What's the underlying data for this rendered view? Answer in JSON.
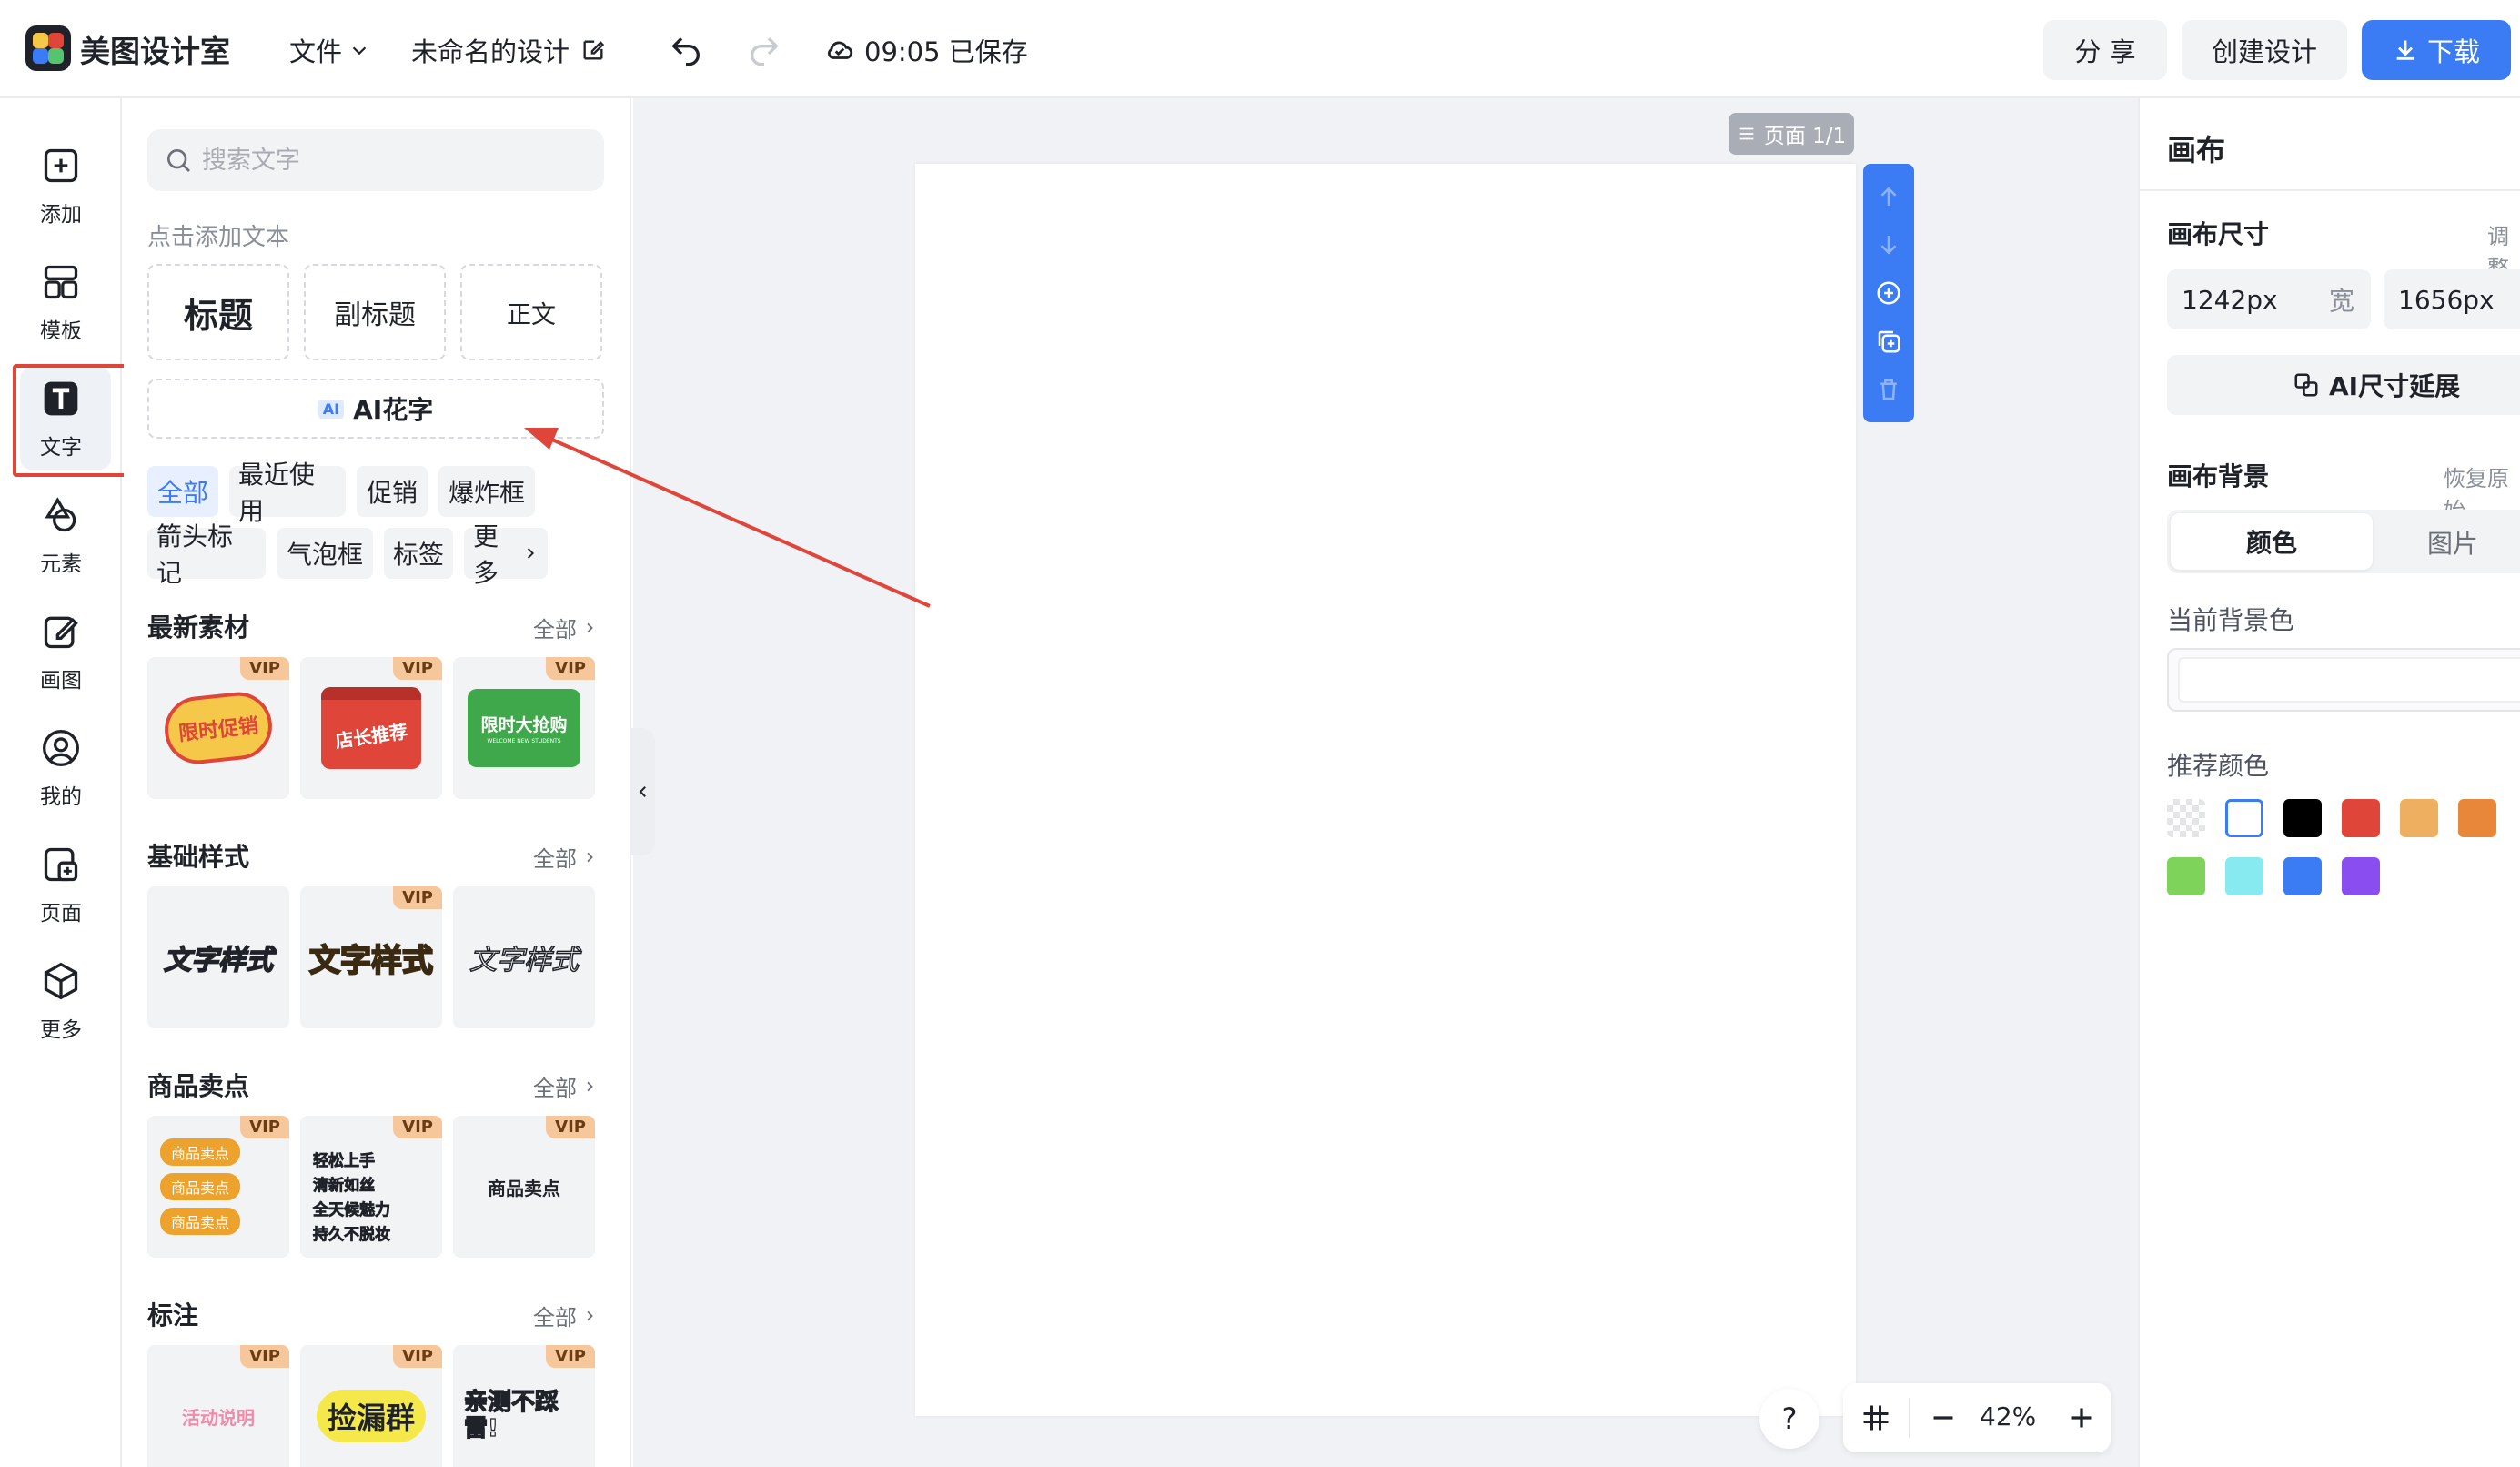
{
  "topbar": {
    "brand": "美图设计室",
    "file_menu": "文件",
    "doc_title": "未命名的设计",
    "save_status": "09:05 已保存",
    "share": "分 享",
    "create": "创建设计",
    "download": "下载"
  },
  "rail": {
    "items": [
      {
        "label": "添加",
        "icon": "plus-square-icon"
      },
      {
        "label": "模板",
        "icon": "template-icon"
      },
      {
        "label": "文字",
        "icon": "text-t-icon"
      },
      {
        "label": "元素",
        "icon": "shapes-icon"
      },
      {
        "label": "画图",
        "icon": "edit-icon"
      },
      {
        "label": "我的",
        "icon": "user-icon"
      },
      {
        "label": "页面",
        "icon": "page-add-icon"
      },
      {
        "label": "更多",
        "icon": "box-icon"
      }
    ],
    "active": "文字"
  },
  "panel": {
    "search_placeholder": "搜索文字",
    "hint": "点击添加文本",
    "title_box": "标题",
    "subtitle_box": "副标题",
    "body_box": "正文",
    "ai_badge": "AI",
    "ai_label": "AI花字",
    "chips_row1": [
      "全部",
      "最近使用",
      "促销",
      "爆炸框"
    ],
    "chips_row2": [
      "箭头标记",
      "气泡框",
      "标签",
      "更多"
    ],
    "all_label": "全部",
    "vip": "VIP",
    "sections": [
      {
        "title": "最新素材",
        "cards": [
          "限时促销",
          "店长推荐",
          "限时大抢购"
        ],
        "card3_sub": "WELCOME NEW STUDENTS"
      },
      {
        "title": "基础样式",
        "cards": [
          "文字样式",
          "文字样式",
          "文字样式"
        ]
      },
      {
        "title": "商品卖点",
        "cards": [
          "商品卖点",
          "轻松上手",
          "商品卖点"
        ],
        "list1": [
          "商品卖点",
          "商品卖点",
          "商品卖点"
        ],
        "list2": [
          "轻松上手",
          "清新如丝",
          "全天候魅力",
          "持久不脱妆"
        ]
      },
      {
        "title": "标注",
        "cards": [
          "活动说明",
          "捡漏群",
          "亲测不踩雷!"
        ]
      }
    ]
  },
  "canvas": {
    "page_badge": "页面 1/1",
    "zoom": "42%",
    "help": "?"
  },
  "right": {
    "heading": "画布",
    "size_label": "画布尺寸",
    "adjust_link": "调整",
    "width_value": "1242px",
    "width_unit": "宽",
    "height_value": "1656px",
    "ai_extend": "AI尺寸延展",
    "bg_label": "画布背景",
    "restore_link": "恢复原始",
    "seg_color": "颜色",
    "seg_image": "图片",
    "current_bg_label": "当前背景色",
    "recommend_label": "推荐颜色",
    "swatches_row1": [
      "transparent",
      "#ffffff",
      "#000000",
      "#e0453a",
      "#eeb060",
      "#e8863a"
    ],
    "swatches_row2": [
      "#7ed35a",
      "#86eaf0",
      "#3b7cf5",
      "#8a4ef0"
    ]
  },
  "colors": {
    "accent": "#3b7cf5",
    "highlight": "#e0453a"
  }
}
